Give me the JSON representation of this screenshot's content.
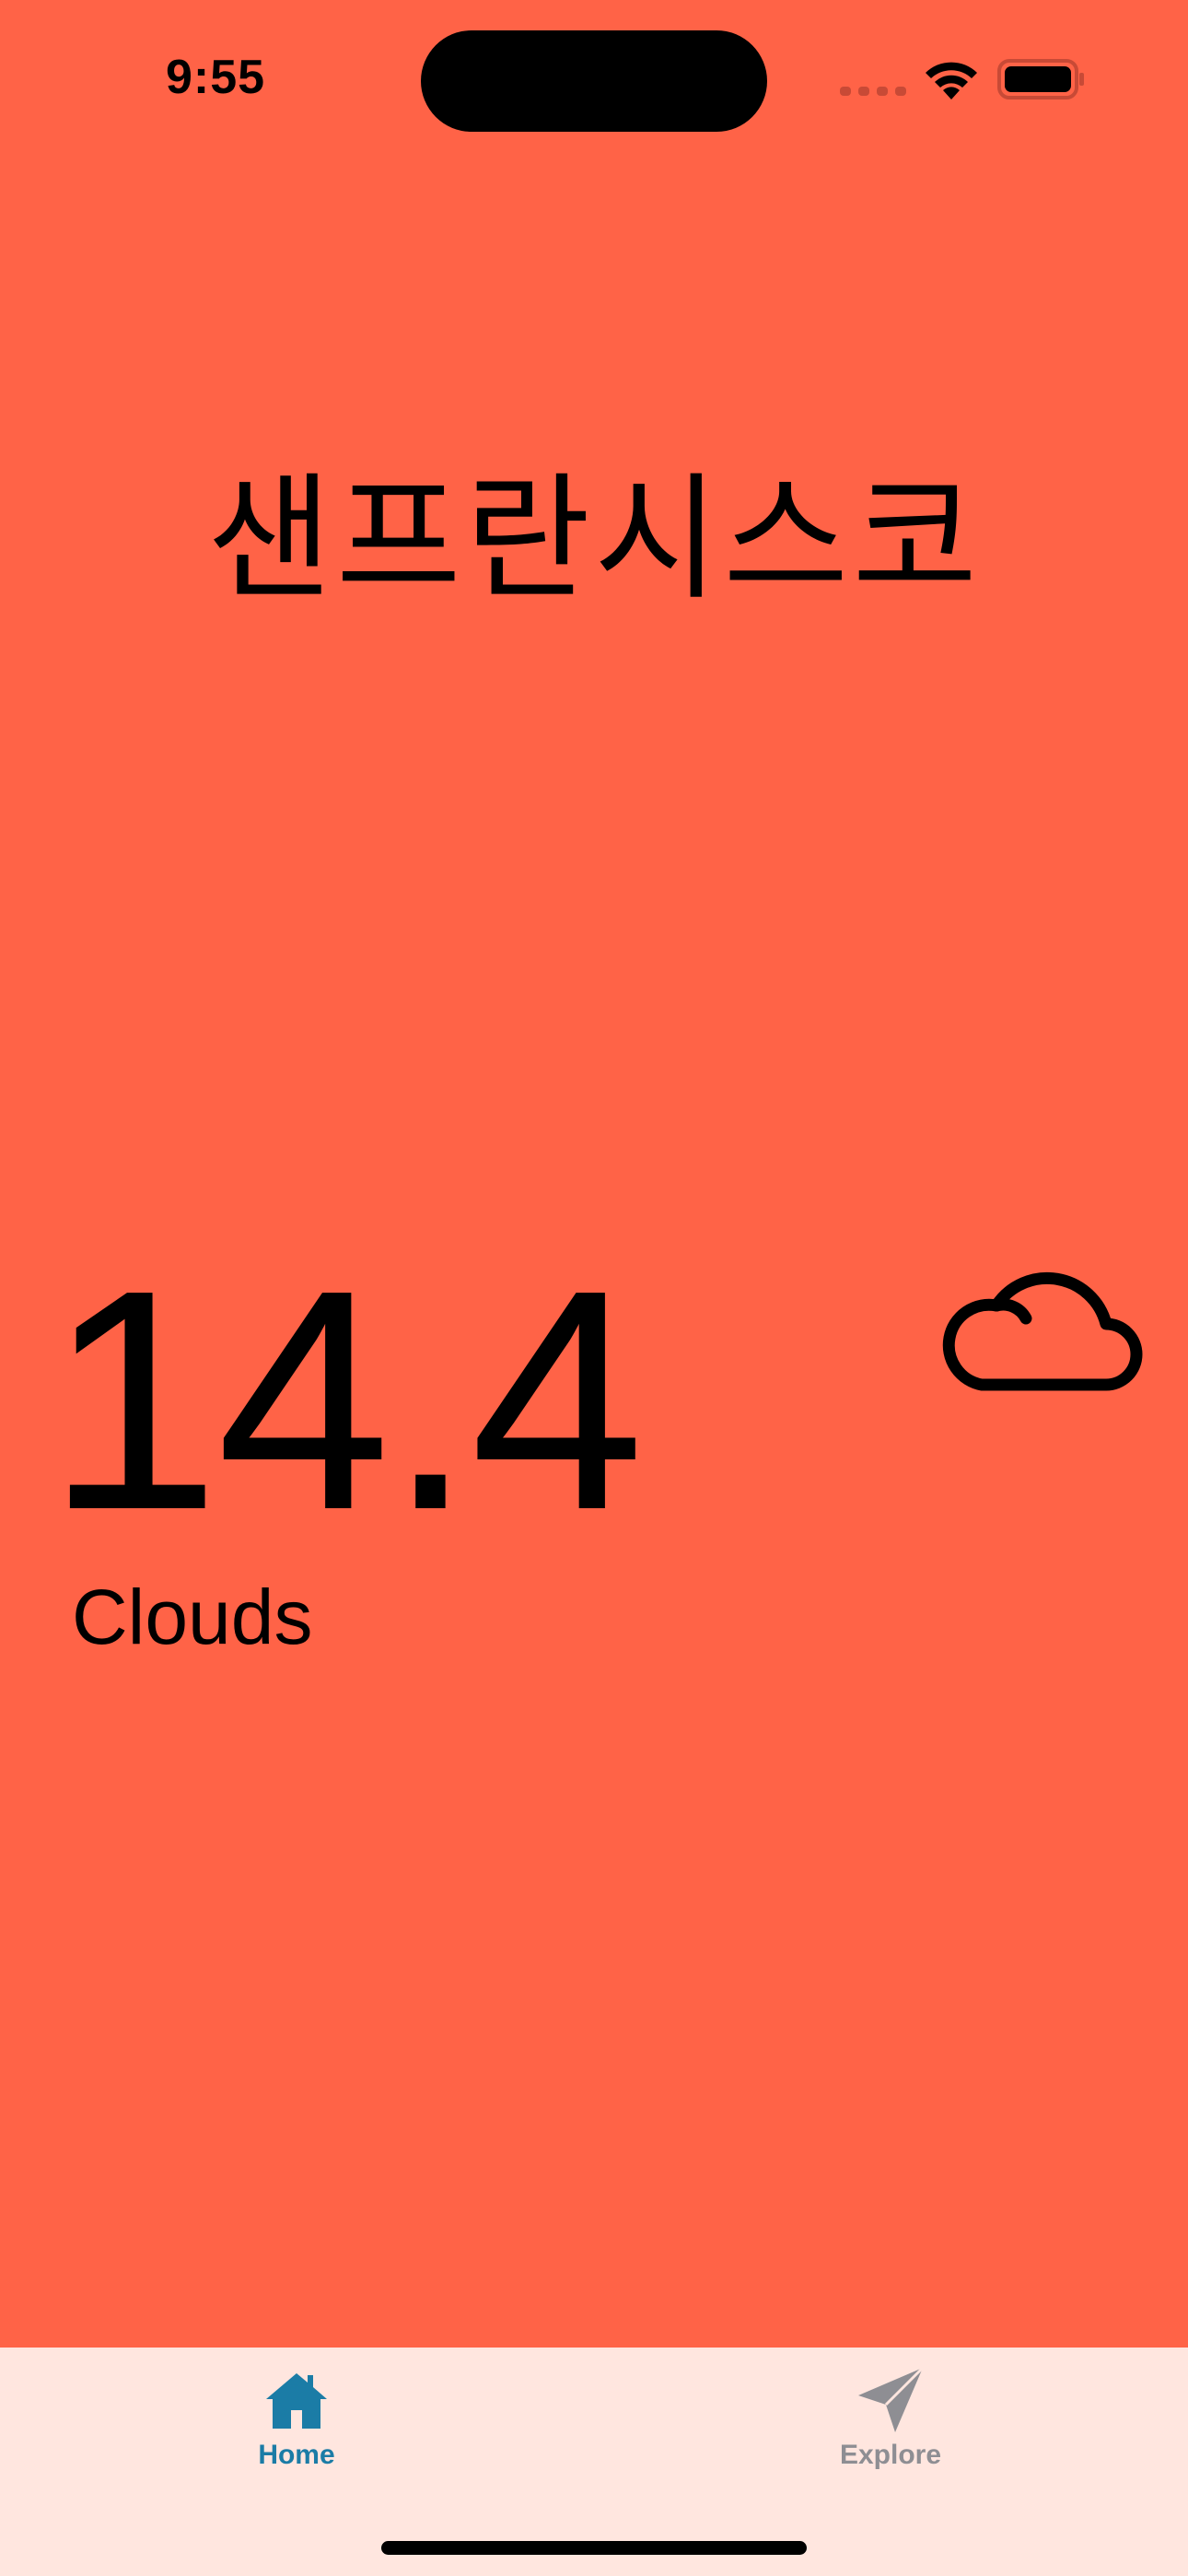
{
  "status_bar": {
    "time": "9:55"
  },
  "main": {
    "city": "샌프란시스코",
    "temperature": "14.4",
    "condition": "Clouds",
    "weather_icon": "cloud-icon"
  },
  "tab_bar": {
    "tabs": [
      {
        "label": "Home",
        "icon": "house-icon",
        "selected": true
      },
      {
        "label": "Explore",
        "icon": "paperplane-icon",
        "selected": false
      }
    ]
  },
  "colors": {
    "background": "#FF6347",
    "tab_bar_background": "#FFE6DF",
    "tab_active": "#1B7CA6",
    "tab_inactive": "#8E8E93"
  }
}
